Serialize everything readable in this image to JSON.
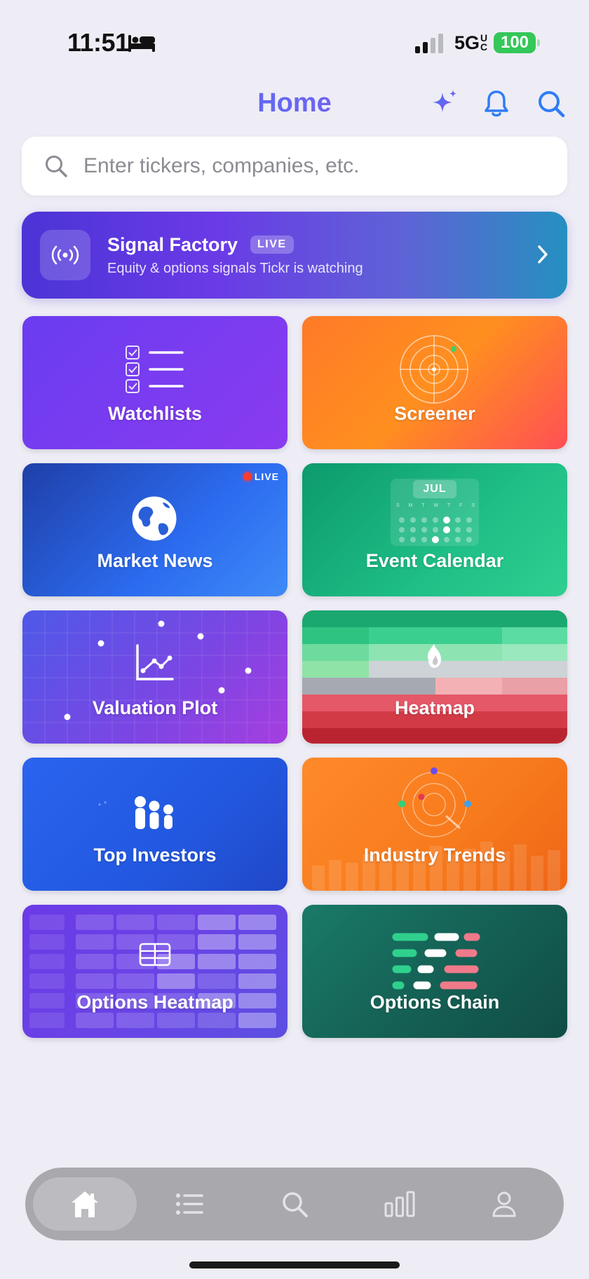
{
  "status_bar": {
    "time": "11:51",
    "network": "5GUC",
    "battery": "100"
  },
  "header": {
    "title": "Home"
  },
  "search": {
    "placeholder": "Enter tickers, companies, etc.",
    "value": ""
  },
  "signal_factory": {
    "title": "Signal Factory",
    "badge": "LIVE",
    "subtitle": "Equity & options signals Tickr is watching"
  },
  "tiles": [
    {
      "label": "Watchlists"
    },
    {
      "label": "Screener"
    },
    {
      "label": "Market News",
      "badge": "LIVE"
    },
    {
      "label": "Event Calendar",
      "month": "JUL",
      "weekdays": [
        "S",
        "M",
        "T",
        "W",
        "T",
        "F",
        "S"
      ]
    },
    {
      "label": "Valuation Plot"
    },
    {
      "label": "Heatmap"
    },
    {
      "label": "Top Investors"
    },
    {
      "label": "Industry Trends"
    },
    {
      "label": "Options Heatmap"
    },
    {
      "label": "Options Chain"
    }
  ],
  "tab_bar": {
    "items": [
      {
        "name": "home",
        "icon": "house-icon",
        "active": true
      },
      {
        "name": "watchlist",
        "icon": "list-icon",
        "active": false
      },
      {
        "name": "search",
        "icon": "magnifier-icon",
        "active": false
      },
      {
        "name": "markets",
        "icon": "bar-chart-icon",
        "active": false
      },
      {
        "name": "profile",
        "icon": "person-icon",
        "active": false
      }
    ]
  },
  "colors": {
    "accent": "#2f7df6",
    "background": "#eeedf6"
  }
}
